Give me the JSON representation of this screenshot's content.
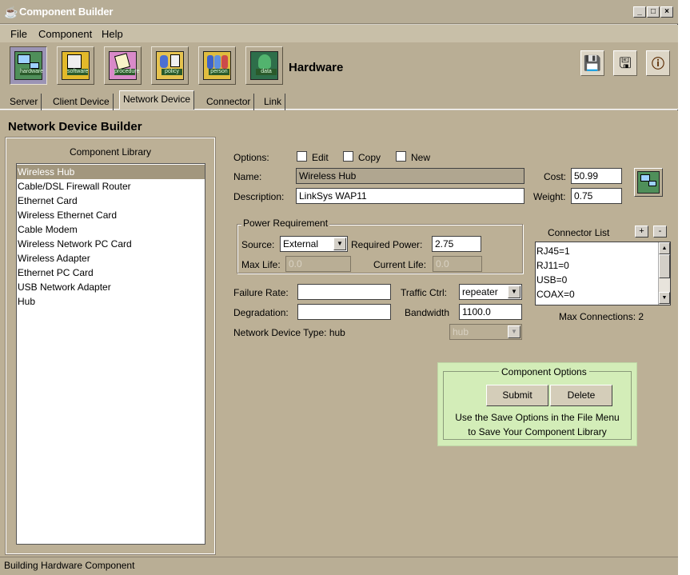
{
  "window": {
    "title": "Component Builder"
  },
  "menu": [
    "File",
    "Component",
    "Help"
  ],
  "toolbar": {
    "buttons": [
      {
        "name": "hardware",
        "tag": "hardware"
      },
      {
        "name": "software",
        "tag": "software"
      },
      {
        "name": "procedure",
        "tag": "procedure"
      },
      {
        "name": "policy",
        "tag": "policy"
      },
      {
        "name": "person",
        "tag": "person"
      },
      {
        "name": "data",
        "tag": "data"
      }
    ],
    "title": "Hardware"
  },
  "tabs": [
    "Server",
    "Client Device",
    "Network Device",
    "Connector",
    "Link"
  ],
  "active_tab": "Network Device",
  "section_title": "Network Device Builder",
  "library": {
    "title": "Component Library",
    "items": [
      "Wireless Hub",
      "Cable/DSL Firewall Router",
      "Ethernet Card",
      "Wireless Ethernet Card",
      "Cable Modem",
      "Wireless Network PC Card",
      "Wireless Adapter",
      "Ethernet PC Card",
      "USB Network Adapter",
      "Hub"
    ],
    "selected": "Wireless Hub"
  },
  "form": {
    "options_label": "Options:",
    "opt_edit": "Edit",
    "opt_copy": "Copy",
    "opt_new": "New",
    "name_label": "Name:",
    "name_value": "Wireless Hub",
    "description_label": "Description:",
    "description_value": "LinkSys WAP11",
    "cost_label": "Cost:",
    "cost_value": "50.99",
    "weight_label": "Weight:",
    "weight_value": "0.75",
    "power": {
      "title": "Power Requirement",
      "source_label": "Source:",
      "source_value": "External",
      "required_label": "Required Power:",
      "required_value": "2.75",
      "max_life_label": "Max Life:",
      "max_life_value": "0.0",
      "current_life_label": "Current Life:",
      "current_life_value": "0.0"
    },
    "failure_rate_label": "Failure Rate:",
    "failure_rate_value": "",
    "degradation_label": "Degradation:",
    "degradation_value": "",
    "traffic_label": "Traffic Ctrl:",
    "traffic_value": "repeater",
    "bandwidth_label": "Bandwidth",
    "bandwidth_value": "1100.0",
    "device_type_label": "Network Device Type: hub",
    "device_type_value": "hub"
  },
  "connectors": {
    "title": "Connector List",
    "add": "+",
    "remove": "-",
    "items": [
      "RJ45=1",
      "RJ11=0",
      "USB=0",
      "COAX=0"
    ],
    "max_connections": "Max Connections: 2"
  },
  "component_options": {
    "title": "Component Options",
    "submit": "Submit",
    "delete": "Delete",
    "line1": "Use the Save Options in the File Menu",
    "line2": "to Save Your Component Library"
  },
  "status": "Building Hardware Component",
  "colors": {
    "chrome": "#b9ae95",
    "selected": "#a2977e",
    "options_bg": "#d3edb8"
  }
}
